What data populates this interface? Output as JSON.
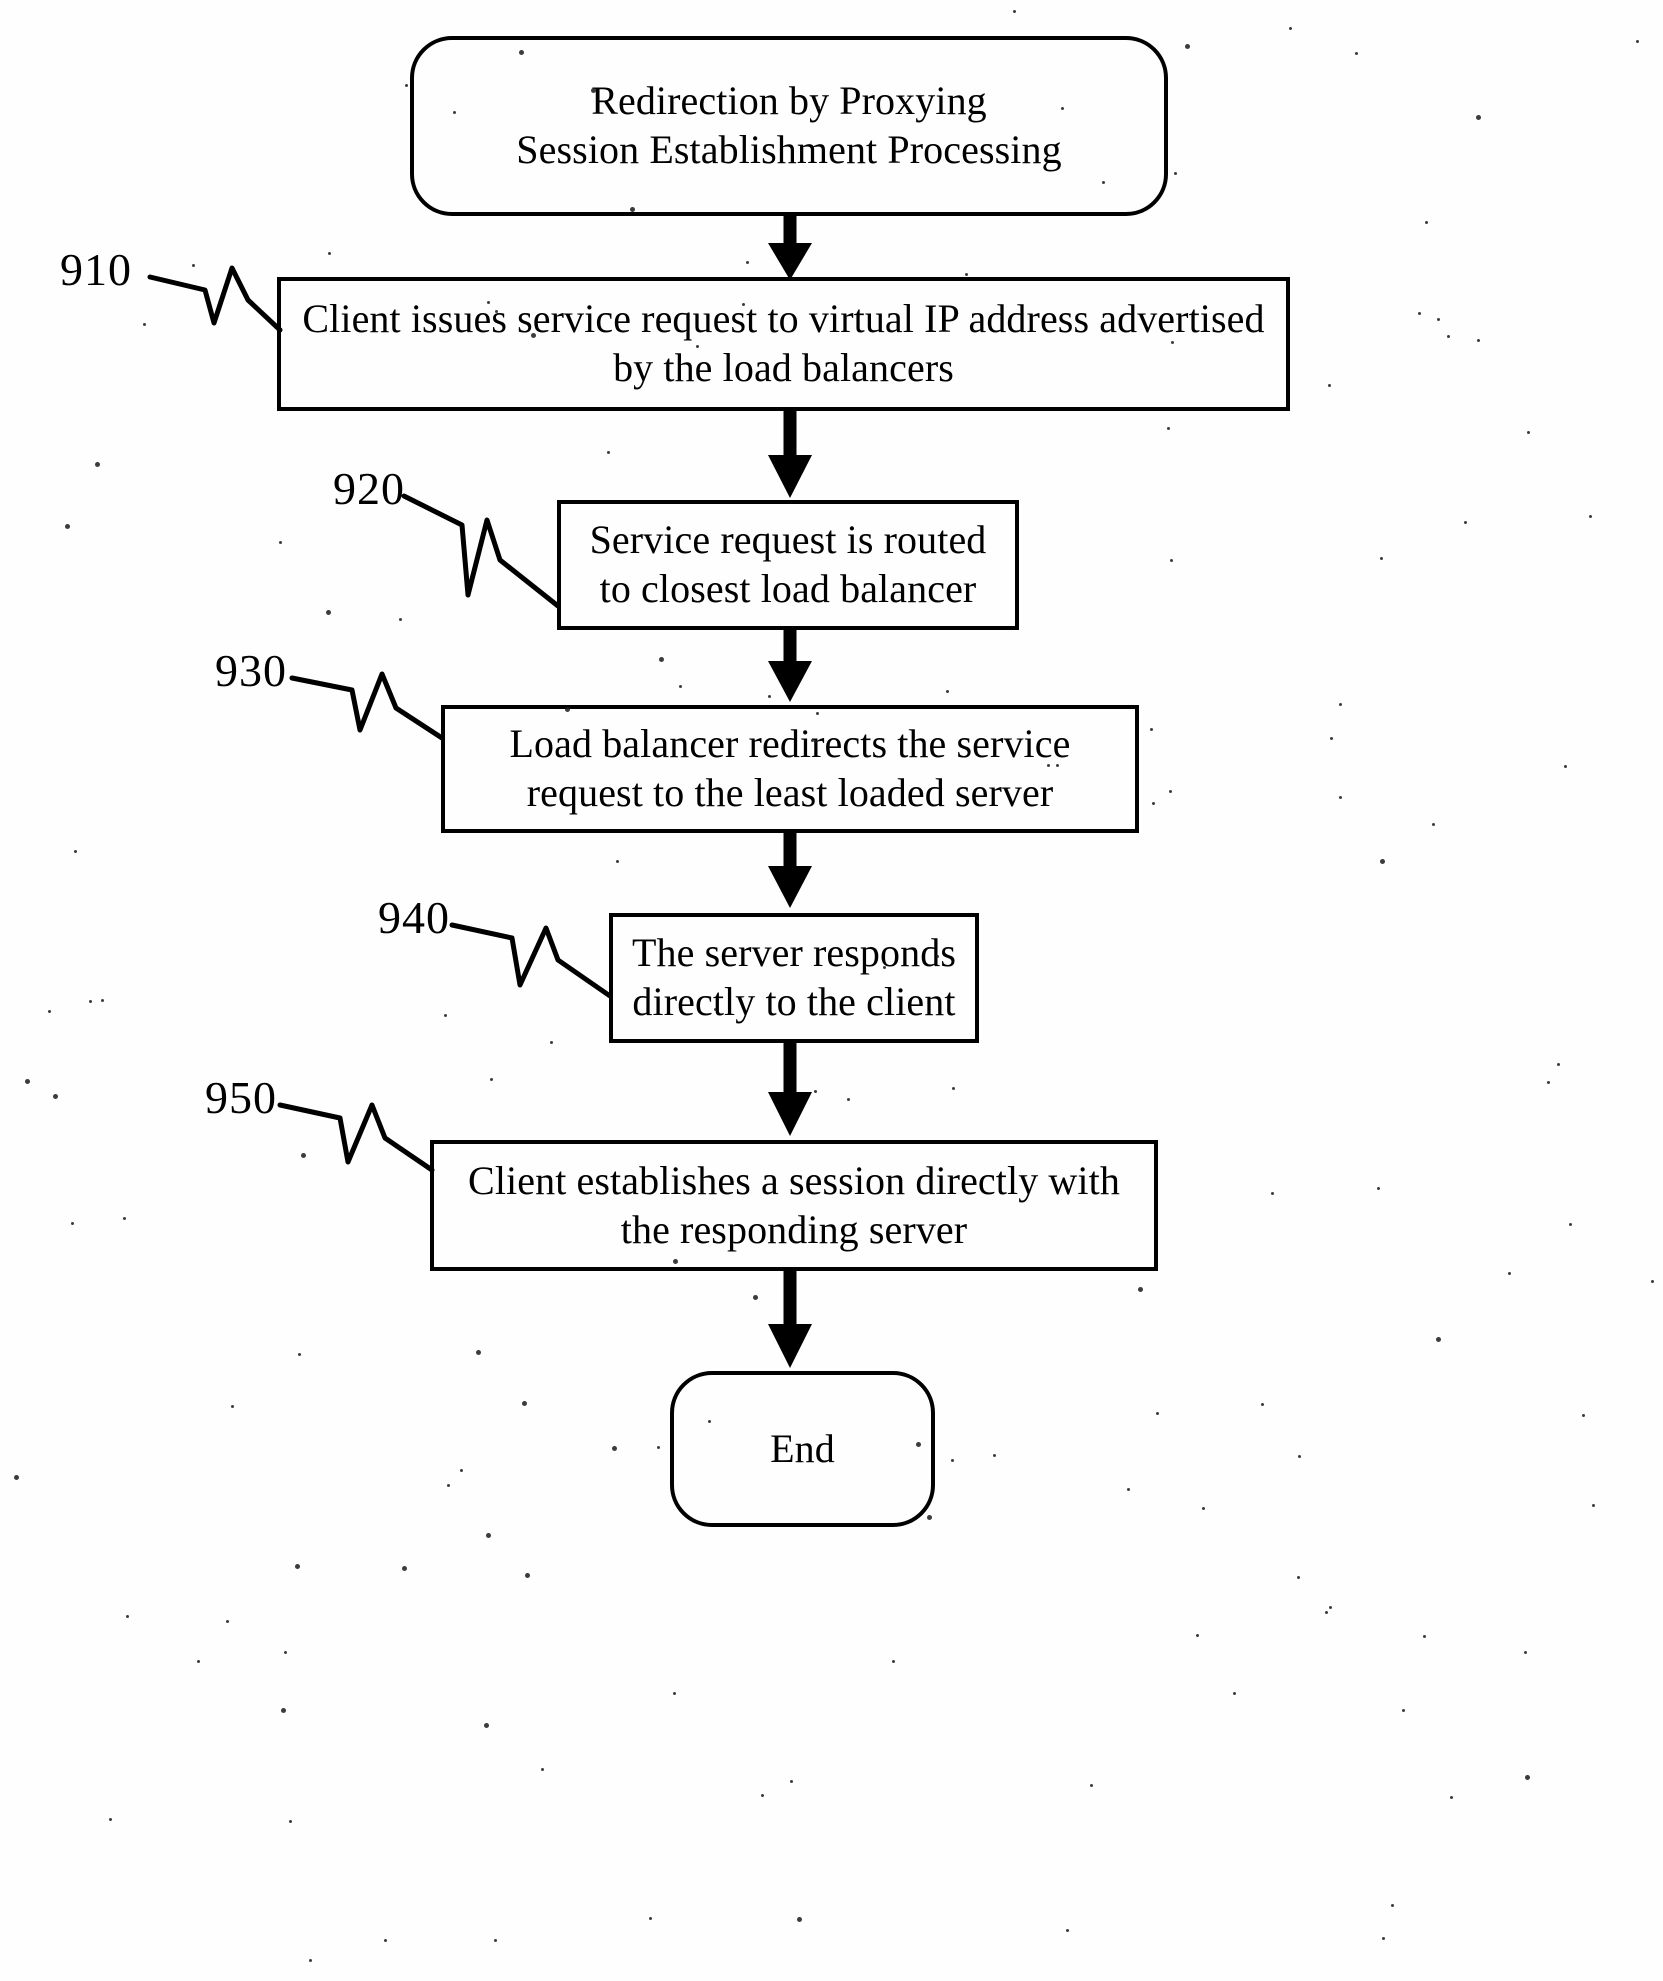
{
  "figure": {
    "type": "flowchart",
    "orientation": "vertical",
    "style": "patent-drawing",
    "ink_color": "#000000",
    "paper_color": "#ffffff"
  },
  "nodes": [
    {
      "id": "start",
      "shape": "rounded-rectangle",
      "text": "Redirection by Proxying\nSession Establishment Processing",
      "ref": null
    },
    {
      "id": "step910",
      "shape": "rectangle",
      "text": "Client issues service request to virtual IP address advertised\nby the load balancers",
      "ref": "910"
    },
    {
      "id": "step920",
      "shape": "rectangle",
      "text": "Service request is routed\nto closest load balancer",
      "ref": "920"
    },
    {
      "id": "step930",
      "shape": "rectangle",
      "text": "Load balancer redirects the service\nrequest to the least loaded server",
      "ref": "930"
    },
    {
      "id": "step940",
      "shape": "rectangle",
      "text": "The server responds\ndirectly to the client",
      "ref": "940"
    },
    {
      "id": "step950",
      "shape": "rectangle",
      "text": "Client establishes a session directly with\nthe responding server",
      "ref": "950"
    },
    {
      "id": "end",
      "shape": "rounded-rectangle",
      "text": "End",
      "ref": null
    }
  ],
  "reference_numerals": [
    {
      "id": "ref910",
      "value": "910"
    },
    {
      "id": "ref920",
      "value": "920"
    },
    {
      "id": "ref930",
      "value": "930"
    },
    {
      "id": "ref940",
      "value": "940"
    },
    {
      "id": "ref950",
      "value": "950"
    }
  ],
  "connectors": [
    {
      "from": "start",
      "to": "step910",
      "style": "solid-filled-arrow"
    },
    {
      "from": "step910",
      "to": "step920",
      "style": "solid-filled-arrow"
    },
    {
      "from": "step920",
      "to": "step930",
      "style": "solid-filled-arrow"
    },
    {
      "from": "step930",
      "to": "step940",
      "style": "solid-filled-arrow"
    },
    {
      "from": "step940",
      "to": "step950",
      "style": "solid-filled-arrow"
    },
    {
      "from": "step950",
      "to": "end",
      "style": "solid-filled-arrow"
    }
  ]
}
